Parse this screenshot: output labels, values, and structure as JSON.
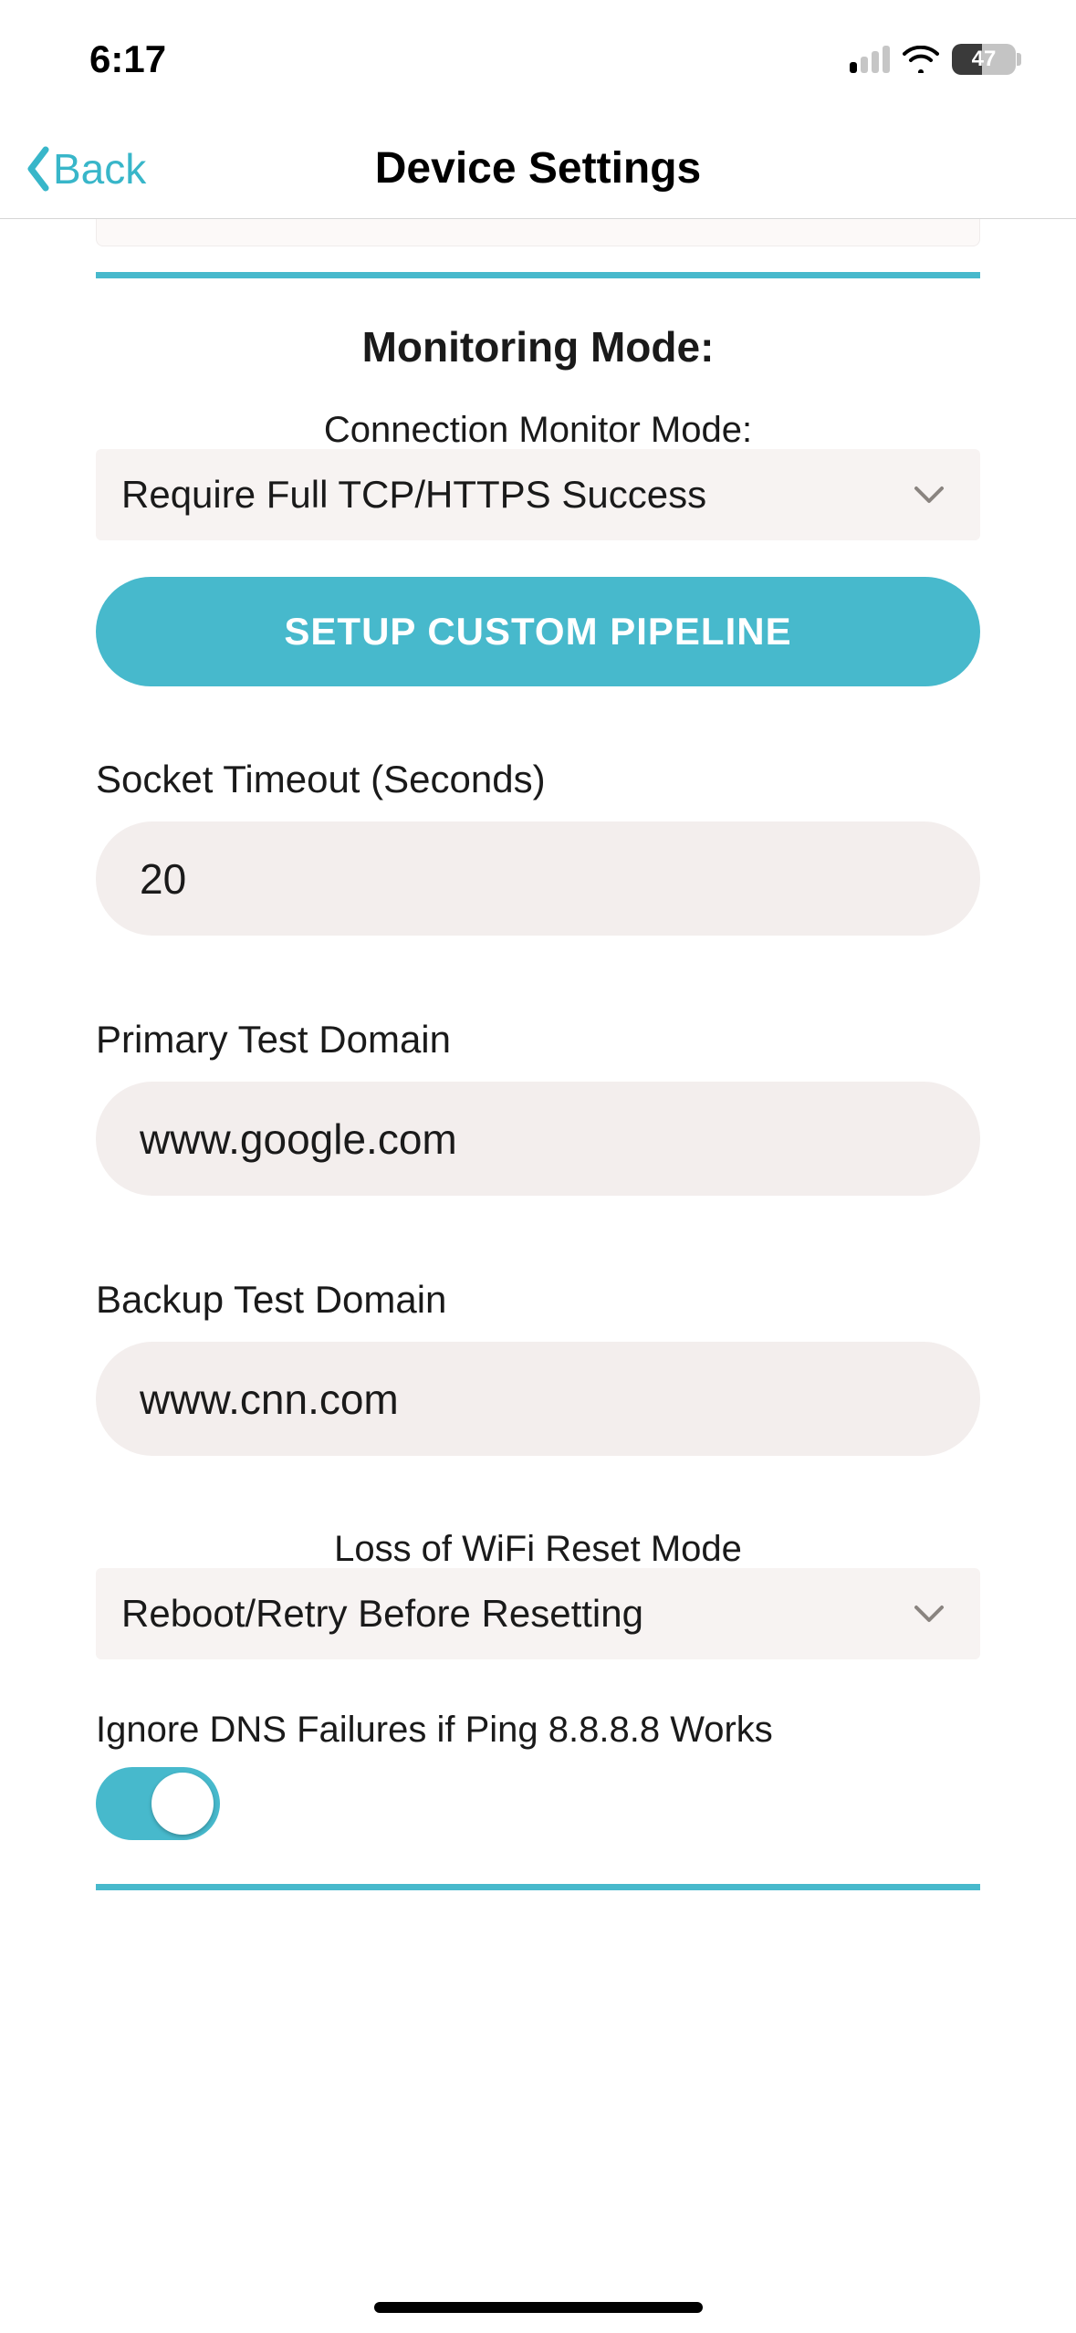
{
  "status": {
    "time": "6:17",
    "battery": "47"
  },
  "nav": {
    "back_label": "Back",
    "title": "Device Settings"
  },
  "monitoring": {
    "section_title": "Monitoring Mode:",
    "connection_label": "Connection Monitor Mode:",
    "connection_value": "Require Full TCP/HTTPS Success",
    "pipeline_button": "SETUP CUSTOM PIPELINE"
  },
  "socket": {
    "label": "Socket Timeout (Seconds)",
    "value": "20"
  },
  "primary_domain": {
    "label": "Primary Test Domain",
    "value": "www.google.com"
  },
  "backup_domain": {
    "label": "Backup Test Domain",
    "value": "www.cnn.com"
  },
  "wifi_reset": {
    "label": "Loss of WiFi Reset Mode",
    "value": "Reboot/Retry Before Resetting"
  },
  "dns_toggle": {
    "label": "Ignore DNS Failures if Ping 8.8.8.8 Works",
    "on": true
  }
}
